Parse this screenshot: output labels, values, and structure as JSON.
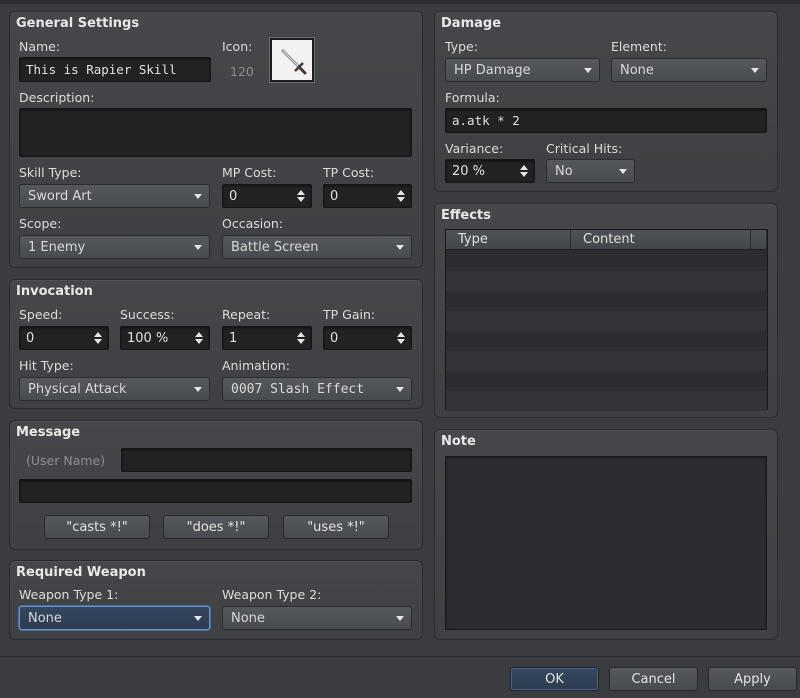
{
  "general": {
    "title": "General Settings",
    "name_label": "Name:",
    "name_value": "This is Rapier Skill",
    "icon_label": "Icon:",
    "icon_index": "120",
    "icon_name": "sword-icon",
    "description_label": "Description:",
    "description_value": "",
    "skill_type_label": "Skill Type:",
    "skill_type_value": "Sword Art",
    "mp_cost_label": "MP Cost:",
    "mp_cost_value": "0",
    "tp_cost_label": "TP Cost:",
    "tp_cost_value": "0",
    "scope_label": "Scope:",
    "scope_value": "1 Enemy",
    "occasion_label": "Occasion:",
    "occasion_value": "Battle Screen"
  },
  "invocation": {
    "title": "Invocation",
    "speed_label": "Speed:",
    "speed_value": "0",
    "success_label": "Success:",
    "success_value": "100 %",
    "repeat_label": "Repeat:",
    "repeat_value": "1",
    "tp_gain_label": "TP Gain:",
    "tp_gain_value": "0",
    "hit_type_label": "Hit Type:",
    "hit_type_value": "Physical Attack",
    "animation_label": "Animation:",
    "animation_value": "0007 Slash Effect"
  },
  "message": {
    "title": "Message",
    "user_name_label": "(User Name)",
    "line1_value": "",
    "line2_value": "",
    "casts_button": "\"casts *!\"",
    "does_button": "\"does *!\"",
    "uses_button": "\"uses *!\""
  },
  "required_weapon": {
    "title": "Required Weapon",
    "type1_label": "Weapon Type 1:",
    "type1_value": "None",
    "type2_label": "Weapon Type 2:",
    "type2_value": "None"
  },
  "damage": {
    "title": "Damage",
    "type_label": "Type:",
    "type_value": "HP Damage",
    "element_label": "Element:",
    "element_value": "None",
    "formula_label": "Formula:",
    "formula_value": "a.atk * 2",
    "variance_label": "Variance:",
    "variance_value": "20 %",
    "critical_label": "Critical Hits:",
    "critical_value": "No"
  },
  "effects": {
    "title": "Effects",
    "columns": [
      "Type",
      "Content"
    ],
    "rows": []
  },
  "note": {
    "title": "Note",
    "value": ""
  },
  "footer": {
    "ok": "OK",
    "cancel": "Cancel",
    "apply": "Apply"
  }
}
